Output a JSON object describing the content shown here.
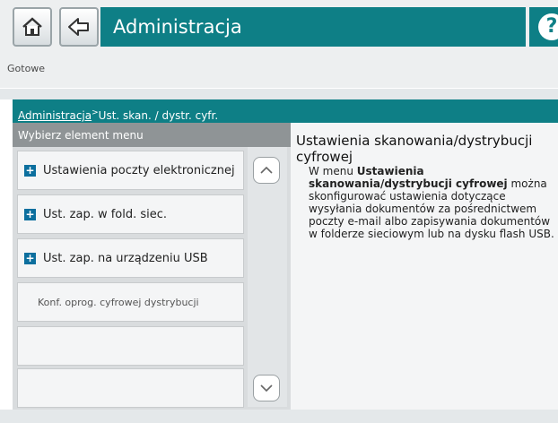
{
  "header": {
    "title": "Administracja",
    "home_icon": "home-icon",
    "back_icon": "back-icon",
    "help_label": "?"
  },
  "status": "Gotowe",
  "breadcrumb": {
    "link": "Administracja",
    "separator": ">",
    "current": "Ust. skan. / dystr. cyfr."
  },
  "menu": {
    "header": "Wybierz element menu",
    "items": [
      {
        "label": "Ustawienia poczty elektronicznej",
        "expandable": true
      },
      {
        "label": "Ust. zap. w fold. siec.",
        "expandable": true
      },
      {
        "label": "Ust. zap. na urządzeniu USB",
        "expandable": true
      },
      {
        "label": "Konf. oprog. cyfrowej dystrybucji",
        "expandable": false
      },
      {
        "label": "",
        "expandable": false
      },
      {
        "label": "",
        "expandable": false
      }
    ],
    "plus_symbol": "+"
  },
  "help": {
    "title": "Ustawienia skanowania/dystrybucji cyfrowej",
    "body_prefix": "W menu ",
    "body_bold": "Ustawienia skanowania/dystrybucji cyfrowej",
    "body_suffix": " można skonfigurować ustawienia dotyczące wysyłania dokumentów za pośrednictwem poczty e-mail albo zapisywania dokumentów w folderze sieciowym lub na dysku flash USB."
  },
  "colors": {
    "accent": "#0e7f86",
    "plus": "#0c6f9e"
  }
}
